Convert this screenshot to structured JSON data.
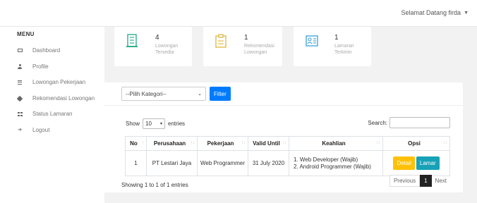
{
  "header": {
    "greeting": "Selamat Datang firda"
  },
  "sidebar": {
    "title": "MENU",
    "items": [
      {
        "label": "Dashboard",
        "icon": "dashboard-icon"
      },
      {
        "label": "Profile",
        "icon": "user-icon"
      },
      {
        "label": "Lowongan Pekerjaan",
        "icon": "list-icon"
      },
      {
        "label": "Rekomendasi Lowongan",
        "icon": "tag-icon"
      },
      {
        "label": "Status Lamaran",
        "icon": "grid-icon"
      },
      {
        "label": "Logout",
        "icon": "logout-icon"
      }
    ]
  },
  "stats": [
    {
      "value": "4",
      "label_1": "Lowongan",
      "label_2": "Tersedia",
      "icon": "building-icon"
    },
    {
      "value": "1",
      "label_1": "Rekomendasi",
      "label_2": "Lowongan",
      "icon": "clipboard-icon"
    },
    {
      "value": "1",
      "label_1": "Lamaran",
      "label_2": "Terkirim",
      "icon": "id-card-icon"
    }
  ],
  "filter": {
    "category_value": "--Pilih Kategori--",
    "button_label": "Filter"
  },
  "table_controls": {
    "show_label": "Show",
    "entries_value": "10",
    "entries_label": "entries",
    "search_label": "Search:"
  },
  "table": {
    "headers": [
      "No",
      "Perusahaan",
      "Pekerjaan",
      "Valid Until",
      "Keahlian",
      "Opsi"
    ],
    "rows": [
      {
        "no": "1",
        "company": "PT Lestari Jaya",
        "job": "Web Programmer",
        "valid_until": "31 July 2020",
        "skill_1": "1. Web Developer (Wajib)",
        "skill_2": "2. Android Programmer (Wajib)",
        "detail_label": "Detail",
        "apply_label": "Lamar"
      }
    ]
  },
  "footer": {
    "info": "Showing 1 to 1 of 1 entries",
    "prev": "Previous",
    "page": "1",
    "next": "Next"
  },
  "colors": {
    "primary": "#007bff",
    "warning": "#ffc107",
    "info": "#17a2b8",
    "icon_teal": "#2eaf8f",
    "icon_yellow": "#e0b53a",
    "icon_blue": "#3aa0d8"
  }
}
